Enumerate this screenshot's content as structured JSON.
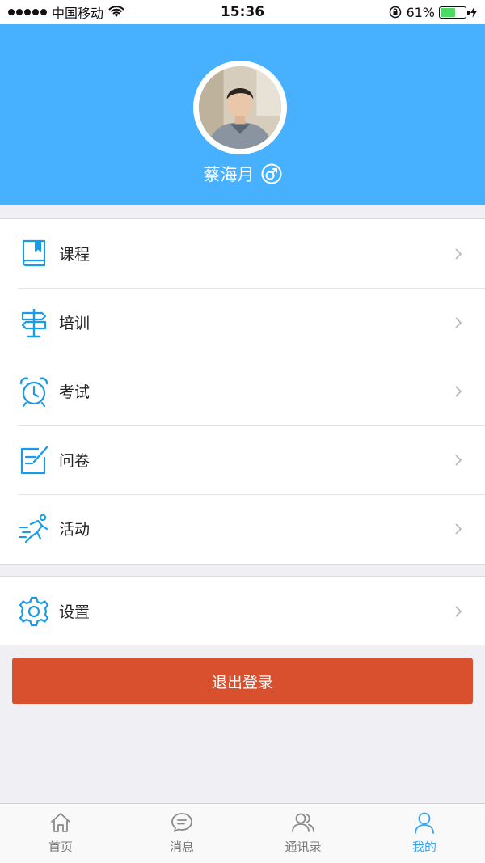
{
  "status_bar": {
    "carrier": "中国移动",
    "time": "15:36",
    "battery_percent": "61%",
    "battery_level": 0.61
  },
  "profile": {
    "username": "蔡海月",
    "gender_icon": "male-symbol-icon"
  },
  "menu": {
    "items": [
      {
        "label": "课程",
        "icon": "book-icon"
      },
      {
        "label": "培训",
        "icon": "signpost-icon"
      },
      {
        "label": "考试",
        "icon": "alarm-clock-icon"
      },
      {
        "label": "问卷",
        "icon": "edit-note-icon"
      },
      {
        "label": "活动",
        "icon": "running-person-icon"
      }
    ],
    "settings": {
      "label": "设置",
      "icon": "gear-icon"
    }
  },
  "logout": {
    "label": "退出登录"
  },
  "tab_bar": {
    "tabs": [
      {
        "label": "首页",
        "icon": "home-icon"
      },
      {
        "label": "消息",
        "icon": "chat-bubble-icon"
      },
      {
        "label": "通讯录",
        "icon": "contacts-icon"
      },
      {
        "label": "我的",
        "icon": "person-icon",
        "active": true
      }
    ]
  },
  "colors": {
    "header_blue": "#47b0ff",
    "icon_blue": "#1a9bea",
    "logout_red": "#d9502f",
    "tab_active": "#3aa3f0"
  }
}
